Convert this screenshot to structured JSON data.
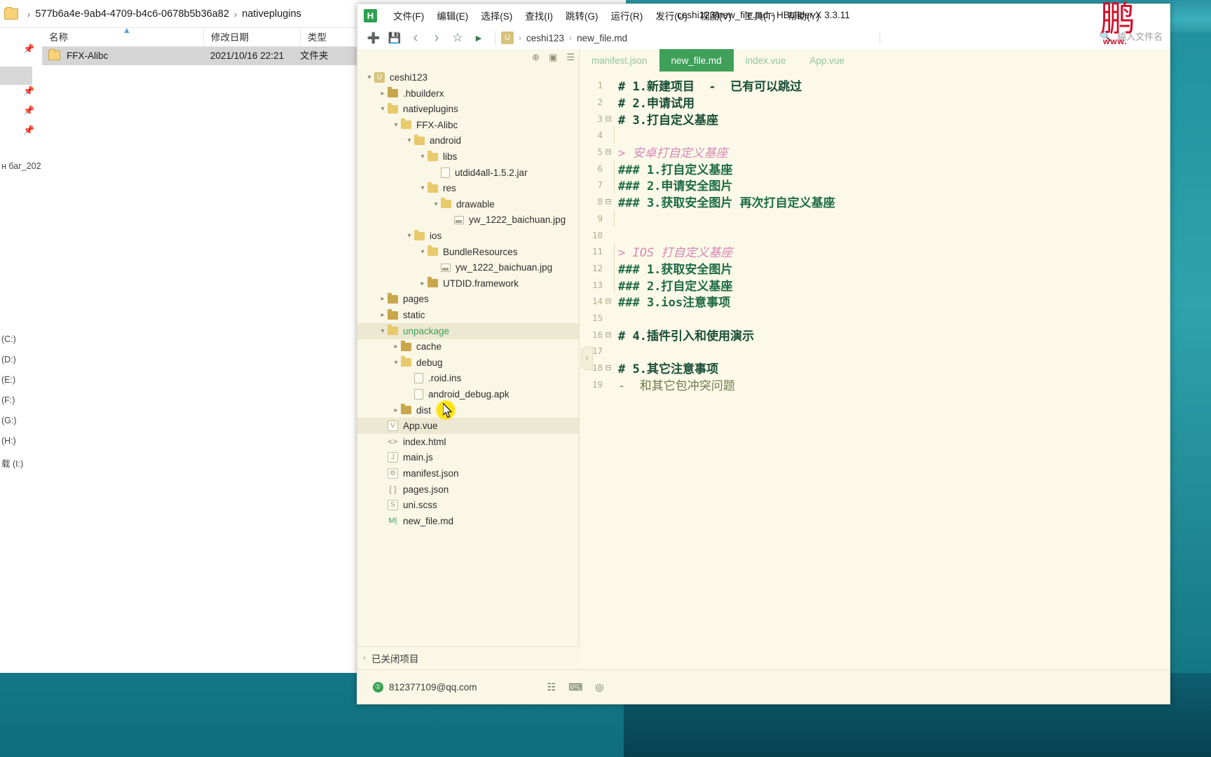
{
  "explorer": {
    "breadcrumb": {
      "folder_icon": "folder-icon",
      "path1": "577b6a4e-9ab4-4709-b4c6-0678b5b36a82",
      "path2": "nativeplugins",
      "sep": "›"
    },
    "columns": [
      {
        "label": "名称"
      },
      {
        "label": "修改日期"
      },
      {
        "label": "类型"
      }
    ],
    "rows": [
      {
        "name": "FFX-Alibc",
        "modified": "2021/10/16 22:21",
        "type": "文件夹"
      }
    ],
    "sidebar_texts": [
      "н баг_202",
      "(C:)",
      "(D:)",
      "(E:)",
      "(F:)",
      "(G:)",
      "(H:)",
      "载 (I:)"
    ]
  },
  "hbuilder": {
    "logo": "H",
    "title": "ceshi123/new_file.md - HBuilder X 3.3.11",
    "menu": [
      {
        "label": "文件(F)"
      },
      {
        "label": "编辑(E)"
      },
      {
        "label": "选择(S)"
      },
      {
        "label": "查找(I)"
      },
      {
        "label": "跳转(G)"
      },
      {
        "label": "运行(R)"
      },
      {
        "label": "发行(U)"
      },
      {
        "label": "视图(V)"
      },
      {
        "label": "工具(T)"
      },
      {
        "label": "帮助(Y)"
      }
    ],
    "toolbar": {
      "icons": [
        {
          "name": "new-file-icon",
          "glyph": "➕"
        },
        {
          "name": "save-icon",
          "glyph": "💾"
        },
        {
          "name": "back-icon",
          "glyph": "‹"
        },
        {
          "name": "forward-icon",
          "glyph": "›"
        },
        {
          "name": "favorite-star-icon",
          "glyph": "☆"
        },
        {
          "name": "run-icon",
          "glyph": "▶"
        }
      ],
      "breadcrumb_chip": "U",
      "breadcrumb": [
        "ceshi123",
        "new_file.md"
      ],
      "filename_search_icon": "file-search-icon",
      "filename_placeholder": "输入文件名"
    },
    "tree_tools": [
      {
        "name": "add-project-icon",
        "glyph": "⊕"
      },
      {
        "name": "collapse-all-icon",
        "glyph": "▣"
      },
      {
        "name": "tree-menu-icon",
        "glyph": "☰"
      }
    ],
    "tree": [
      {
        "depth": 0,
        "arrow": "open",
        "icon": "ulogo",
        "label": "ceshi123",
        "selected": false
      },
      {
        "depth": 1,
        "arrow": "closed",
        "icon": "folder-dark",
        "label": ".hbuilderx",
        "selected": false
      },
      {
        "depth": 1,
        "arrow": "open",
        "icon": "folder",
        "label": "nativeplugins",
        "selected": false
      },
      {
        "depth": 2,
        "arrow": "open",
        "icon": "folder",
        "label": "FFX-Alibc",
        "selected": false
      },
      {
        "depth": 3,
        "arrow": "open",
        "icon": "folder",
        "label": "android",
        "selected": false
      },
      {
        "depth": 4,
        "arrow": "open",
        "icon": "folder",
        "label": "libs",
        "selected": false
      },
      {
        "depth": 5,
        "arrow": "none",
        "icon": "file",
        "label": "utdid4all-1.5.2.jar",
        "selected": false
      },
      {
        "depth": 4,
        "arrow": "open",
        "icon": "folder",
        "label": "res",
        "selected": false
      },
      {
        "depth": 5,
        "arrow": "open",
        "icon": "folder",
        "label": "drawable",
        "selected": false
      },
      {
        "depth": 6,
        "arrow": "none",
        "icon": "image",
        "label": "yw_1222_baichuan.jpg",
        "selected": false
      },
      {
        "depth": 3,
        "arrow": "open",
        "icon": "folder",
        "label": "ios",
        "selected": false
      },
      {
        "depth": 4,
        "arrow": "open",
        "icon": "folder",
        "label": "BundleResources",
        "selected": false
      },
      {
        "depth": 5,
        "arrow": "none",
        "icon": "image",
        "label": "yw_1222_baichuan.jpg",
        "selected": false
      },
      {
        "depth": 4,
        "arrow": "closed",
        "icon": "folder-dark",
        "label": "UTDID.framework",
        "selected": false
      },
      {
        "depth": 1,
        "arrow": "closed",
        "icon": "folder-dark",
        "label": "pages",
        "selected": false
      },
      {
        "depth": 1,
        "arrow": "closed",
        "icon": "folder-dark",
        "label": "static",
        "selected": false
      },
      {
        "depth": 1,
        "arrow": "open",
        "icon": "folder",
        "label": "unpackage",
        "selected": true,
        "green": true
      },
      {
        "depth": 2,
        "arrow": "closed",
        "icon": "folder-dark",
        "label": "cache",
        "selected": false
      },
      {
        "depth": 2,
        "arrow": "open",
        "icon": "folder",
        "label": "debug",
        "selected": false
      },
      {
        "depth": 3,
        "arrow": "none",
        "icon": "file",
        "label": ".roid.ins",
        "selected": false
      },
      {
        "depth": 3,
        "arrow": "none",
        "icon": "file",
        "label": "android_debug.apk",
        "selected": false
      },
      {
        "depth": 2,
        "arrow": "closed",
        "icon": "folder-dark",
        "label": "dist",
        "selected": false
      },
      {
        "depth": 1,
        "arrow": "none",
        "icon": "vue",
        "label": "App.vue",
        "selected": true
      },
      {
        "depth": 1,
        "arrow": "none",
        "icon": "html",
        "label": "index.html",
        "selected": false
      },
      {
        "depth": 1,
        "arrow": "none",
        "icon": "js",
        "label": "main.js",
        "selected": false
      },
      {
        "depth": 1,
        "arrow": "none",
        "icon": "json",
        "label": "manifest.json",
        "selected": false
      },
      {
        "depth": 1,
        "arrow": "none",
        "icon": "brackets",
        "label": "pages.json",
        "selected": false
      },
      {
        "depth": 1,
        "arrow": "none",
        "icon": "scss",
        "label": "uni.scss",
        "selected": false
      },
      {
        "depth": 1,
        "arrow": "none",
        "icon": "md",
        "label": "new_file.md",
        "selected": false
      }
    ],
    "closed_projects": {
      "arrow": "›",
      "label": "已关闭项目"
    },
    "status": {
      "avatar": "①",
      "account": "812377109@qq.com",
      "icons": [
        {
          "name": "outline-icon",
          "glyph": "☷"
        },
        {
          "name": "terminal-icon",
          "glyph": "⌨"
        },
        {
          "name": "browser-icon",
          "glyph": "◎"
        }
      ]
    },
    "tabs": [
      {
        "label": "manifest.json",
        "active": false
      },
      {
        "label": "new_file.md",
        "active": true
      },
      {
        "label": "index.vue",
        "active": false
      },
      {
        "label": "App.vue",
        "active": false
      }
    ],
    "code": [
      {
        "n": 1,
        "fold": "",
        "guide": false,
        "text": "# 1.新建项目  -  已有可以跳过",
        "style": "c-h1"
      },
      {
        "n": 2,
        "fold": "",
        "guide": false,
        "text": "# 2.申请试用",
        "style": "c-h1"
      },
      {
        "n": 3,
        "fold": "⊟",
        "guide": false,
        "text": "# 3.打自定义基座",
        "style": "c-h1"
      },
      {
        "n": 4,
        "fold": "",
        "guide": true,
        "text": "",
        "style": "c-h1"
      },
      {
        "n": 5,
        "fold": "⊟",
        "guide": false,
        "text": "> 安卓打自定义基座",
        "style": "c-quote"
      },
      {
        "n": 6,
        "fold": "",
        "guide": true,
        "text": "### 1.打自定义基座",
        "style": "c-h3"
      },
      {
        "n": 7,
        "fold": "",
        "guide": true,
        "text": "### 2.申请安全图片",
        "style": "c-h3"
      },
      {
        "n": 8,
        "fold": "⊟",
        "guide": false,
        "text": "### 3.获取安全图片 再次打自定义基座",
        "style": "c-h3"
      },
      {
        "n": 9,
        "fold": "",
        "guide": true,
        "text": "",
        "style": "c-h3"
      },
      {
        "n": 10,
        "fold": "",
        "guide": false,
        "text": "",
        "style": "c-h3"
      },
      {
        "n": 11,
        "fold": "",
        "guide": true,
        "text": "> IOS 打自定义基座",
        "style": "c-quote"
      },
      {
        "n": 12,
        "fold": "",
        "guide": true,
        "text": "### 1.获取安全图片",
        "style": "c-h3"
      },
      {
        "n": 13,
        "fold": "",
        "guide": true,
        "text": "### 2.打自定义基座",
        "style": "c-h3"
      },
      {
        "n": 14,
        "fold": "⊟",
        "guide": false,
        "text": "### 3.ios注意事项",
        "style": "c-h3"
      },
      {
        "n": 15,
        "fold": "",
        "guide": false,
        "text": "",
        "style": "c-h3"
      },
      {
        "n": 16,
        "fold": "⊟",
        "guide": false,
        "text": "# 4.插件引入和使用演示",
        "style": "c-h1"
      },
      {
        "n": 17,
        "fold": "",
        "guide": false,
        "text": "",
        "style": "c-h1"
      },
      {
        "n": 18,
        "fold": "⊟",
        "guide": false,
        "text": "# 5.其它注意事项",
        "style": "c-h1"
      },
      {
        "n": 19,
        "fold": "",
        "guide": false,
        "text": "-  和其它包冲突问题",
        "style": "c-li"
      }
    ],
    "collapse_handle": "‹"
  },
  "watermark": {
    "bird": "鹏",
    "text": "www."
  },
  "colors": {
    "editor_bg": "#fcf9e8",
    "panel_bg": "#faf7e6",
    "accent_green": "#3fa05a",
    "heading_green": "#184d36",
    "quote_pink": "#d489b8",
    "selection": "#ece8d2",
    "desktop_teal": "#2fa3ad"
  }
}
